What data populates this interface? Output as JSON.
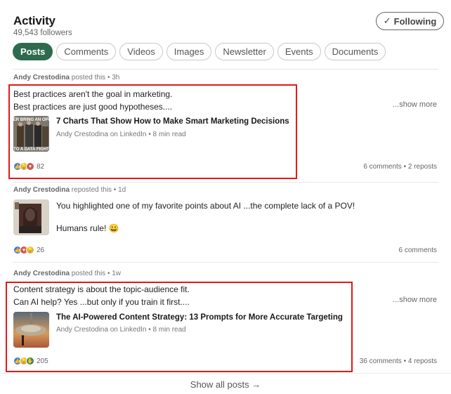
{
  "header": {
    "title": "Activity",
    "followers": "49,543 followers",
    "follow_button": {
      "check": "✓",
      "label": "Following"
    }
  },
  "filters": [
    {
      "label": "Posts",
      "active": true
    },
    {
      "label": "Comments"
    },
    {
      "label": "Videos"
    },
    {
      "label": "Images"
    },
    {
      "label": "Newsletter"
    },
    {
      "label": "Events"
    },
    {
      "label": "Documents"
    }
  ],
  "posts": [
    {
      "author": "Andy Crestodina",
      "action": "posted this",
      "time": "3h",
      "lines": [
        "Best practices aren't the goal in marketing.",
        "Best practices are just good hypotheses...."
      ],
      "show_more": "...show more",
      "article": {
        "title": "7 Charts That Show How to Make Smart Marketing Decisions",
        "subtitle": "Andy Crestodina on LinkedIn • 8 min read",
        "thumb_caption_top": "ER BRING AN OPI",
        "thumb_caption_bottom": "TO A DATA FIGHT"
      },
      "reactions": [
        "like",
        "insightful",
        "love"
      ],
      "reaction_count": "82",
      "stats": "6 comments • 2 reposts",
      "highlighted": true
    },
    {
      "author": "Andy Crestodina",
      "action": "reposted this",
      "time": "1d",
      "lines": [
        "You highlighted one of my favorite points about AI ...the complete lack of a POV!",
        "Humans rule! 😀"
      ],
      "reactions": [
        "like",
        "love",
        "insightful"
      ],
      "reaction_count": "26",
      "stats": "6 comments",
      "highlighted": false
    },
    {
      "author": "Andy Crestodina",
      "action": "posted this",
      "time": "1w",
      "lines": [
        "Content strategy is about the topic-audience fit.",
        "Can AI help? Yes ...but only if you train it first...."
      ],
      "show_more": "...show more",
      "article": {
        "title": "The AI-Powered Content Strategy: 13 Prompts for More Accurate Targeting",
        "subtitle": "Andy Crestodina on LinkedIn • 8 min read"
      },
      "reactions": [
        "like",
        "insightful",
        "support"
      ],
      "reaction_count": "205",
      "stats": "36 comments • 4 reposts",
      "highlighted": true
    }
  ],
  "footer": {
    "show_all": "Show all posts →"
  },
  "colors": {
    "accent": "#2e6b4e",
    "highlight": "#e01919"
  }
}
